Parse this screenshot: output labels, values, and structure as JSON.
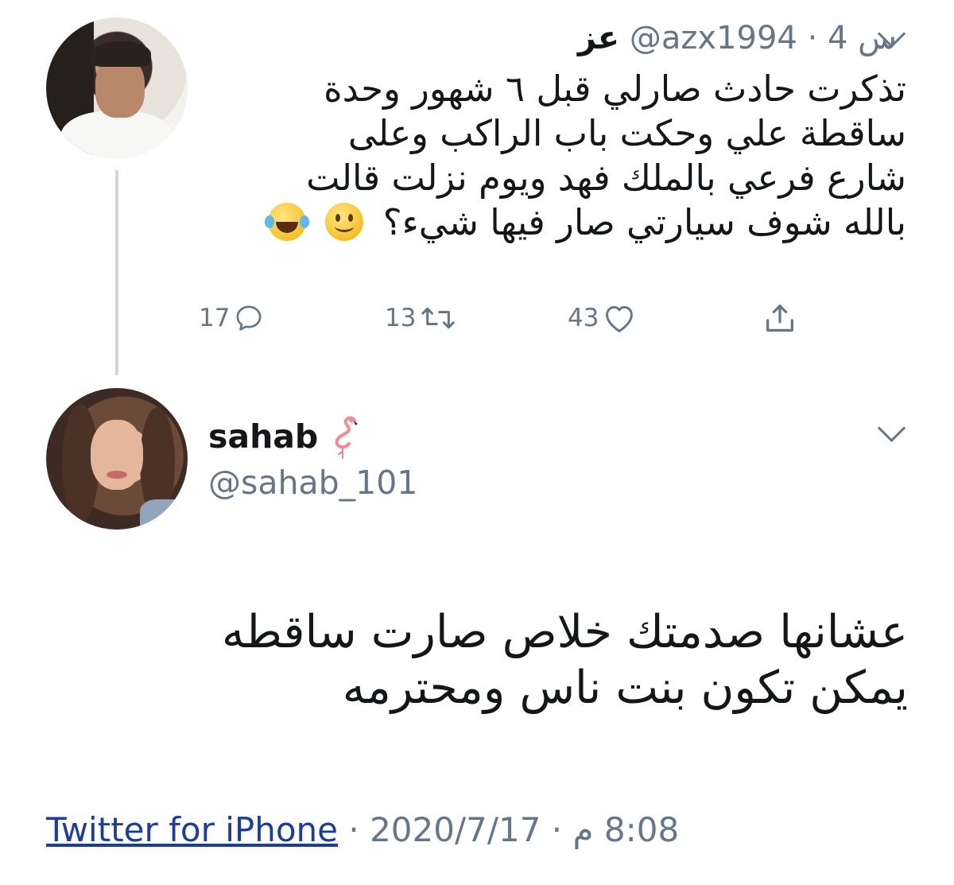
{
  "tweet": {
    "header": {
      "name": "عز",
      "handle": "@azx1994",
      "separator": "·",
      "time": "4 س"
    },
    "text_lines": [
      "تذكرت حادث صارلي قبل ٦ شهور وحدة",
      "ساقطة علي وحكت باب الراكب وعلى",
      "شارع فرعي بالملك فهد ويوم نزلت قالت",
      "بالله شوف سيارتي صار فيها شيء؟"
    ],
    "emojis": [
      "slightly-smiling-face-icon",
      "face-with-tears-of-joy-icon"
    ],
    "actions": {
      "replies": "17",
      "retweets": "13",
      "likes": "43"
    }
  },
  "reply": {
    "name": "sahab",
    "name_emoji": "flamingo-icon",
    "handle": "@sahab_101",
    "text_lines": [
      "عشانها صدمتك خلاص صارت ساقطه",
      "يمكن تكون بنت ناس ومحترمه"
    ],
    "footer": {
      "source": "Twitter for iPhone",
      "separator": "·",
      "date": "2020/7/17",
      "time": "8:08 م"
    }
  },
  "colors": {
    "text": "#14171a",
    "muted": "#657786",
    "link": "#1b3e9b",
    "thread_line": "#ccd6dd"
  }
}
